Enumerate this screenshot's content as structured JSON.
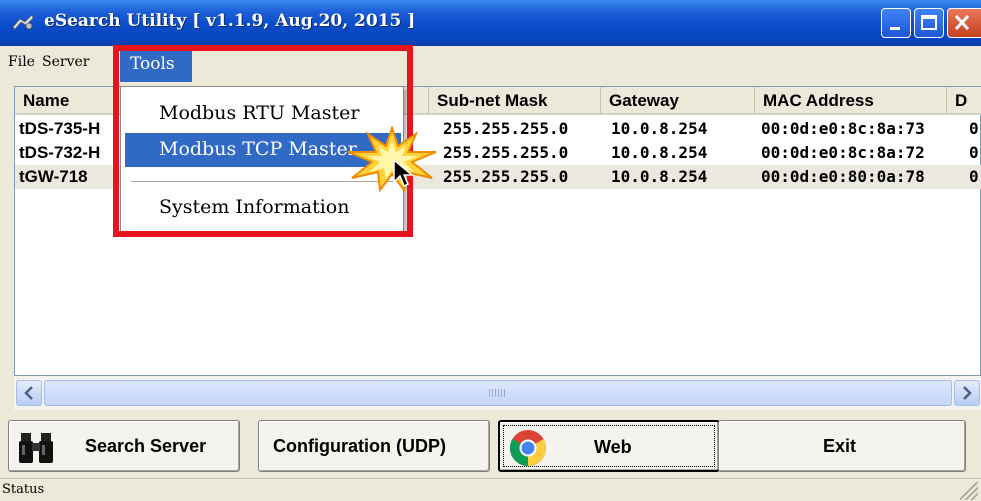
{
  "window": {
    "title": "eSearch Utility [ v1.1.9, Aug.20, 2015 ]",
    "icon": "esearch-app-icon",
    "controls": [
      "minimize",
      "maximize",
      "close"
    ]
  },
  "menubar": {
    "file": "File",
    "server": "Server",
    "tools": "Tools"
  },
  "tools_menu": {
    "items": [
      {
        "label": "Modbus RTU Master",
        "highlighted": false
      },
      {
        "label": "Modbus TCP Master",
        "highlighted": true
      },
      {
        "label": "System Information",
        "highlighted": false
      }
    ]
  },
  "table": {
    "columns": [
      "Name",
      "Sub-net Mask",
      "Gateway",
      "MAC Address",
      "D"
    ],
    "rows": [
      {
        "name": "tDS-735-H",
        "subnet": "255.255.255.0",
        "gateway": "10.0.8.254",
        "mac": "00:0d:e0:8c:8a:73",
        "d": "0"
      },
      {
        "name": "tDS-732-H",
        "subnet": "255.255.255.0",
        "gateway": "10.0.8.254",
        "mac": "00:0d:e0:8c:8a:72",
        "d": "0"
      },
      {
        "name": "tGW-718",
        "subnet": "255.255.255.0",
        "gateway": "10.0.8.254",
        "mac": "00:0d:e0:80:0a:78",
        "d": "0",
        "selected": true
      }
    ]
  },
  "buttons": {
    "search": "Search Server",
    "config": "Configuration (UDP)",
    "web": "Web",
    "exit": "Exit"
  },
  "status": {
    "text": "Status"
  },
  "colors": {
    "titlebar": "#0a4cc8",
    "highlight": "#316ac5",
    "annotation_red": "#e8141d",
    "burst_yellow": "#ffd23a"
  }
}
